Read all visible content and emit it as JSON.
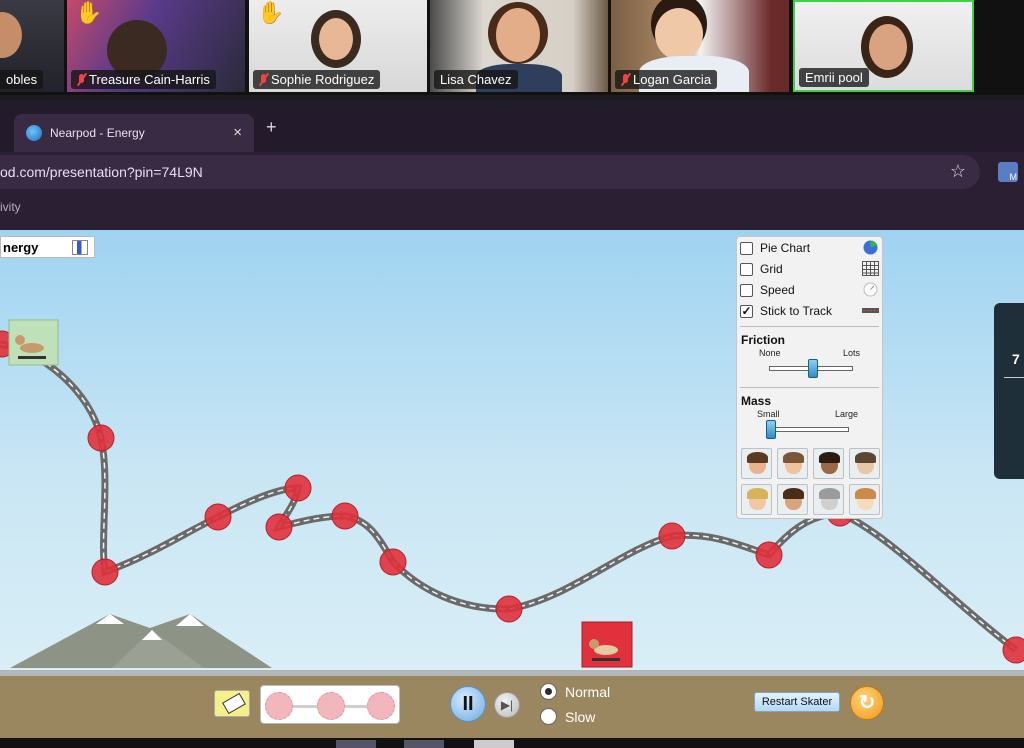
{
  "video_call": {
    "participants": [
      {
        "name": "obles",
        "muted": false,
        "hand_raised": false
      },
      {
        "name": "Treasure Cain-Harris",
        "muted": true,
        "hand_raised": true
      },
      {
        "name": "Sophie Rodriguez",
        "muted": true,
        "hand_raised": true
      },
      {
        "name": "Lisa Chavez",
        "muted": false,
        "hand_raised": false
      },
      {
        "name": "Logan Garcia",
        "muted": true,
        "hand_raised": false
      },
      {
        "name": "Emrii  pool",
        "muted": false,
        "hand_raised": false,
        "active_speaker": true
      }
    ],
    "hand_icon": "raised-hand-icon",
    "active_speaker_color": "#3fd14a"
  },
  "browser": {
    "tab_title": "Nearpod - Energy",
    "tab_close": "×",
    "new_tab": "+",
    "url": "od.com/presentation?pin=74L9N",
    "bookmark_text": "ivity",
    "extension_badge": "M"
  },
  "sim": {
    "energy_button_label": "nergy",
    "options": [
      {
        "label": "Pie Chart",
        "checked": false,
        "icon": "pie-chart-icon"
      },
      {
        "label": "Grid",
        "checked": false,
        "icon": "grid-icon"
      },
      {
        "label": "Speed",
        "checked": false,
        "icon": "speedometer-icon"
      },
      {
        "label": "Stick to Track",
        "checked": true,
        "icon": "track-icon"
      }
    ],
    "friction": {
      "title": "Friction",
      "min_label": "None",
      "max_label": "Lots",
      "value": 0.52
    },
    "mass": {
      "title": "Mass",
      "min_label": "Small",
      "max_label": "Large",
      "value": 0.0
    },
    "characters": [
      {
        "name": "girl-dark-hair",
        "hair": "#5a3a22",
        "skin": "#e9b48d"
      },
      {
        "name": "girl-bun",
        "hair": "#7a5636",
        "skin": "#f0c39f"
      },
      {
        "name": "boy-dark-skin",
        "hair": "#2b1b10",
        "skin": "#9a6a45"
      },
      {
        "name": "boy-short-hair",
        "hair": "#5b4633",
        "skin": "#e7c7a6"
      },
      {
        "name": "boy-blond",
        "hair": "#d8b25a",
        "skin": "#f1c7a1"
      },
      {
        "name": "girl-brown-hair",
        "hair": "#4a2d18",
        "skin": "#d7a47c"
      },
      {
        "name": "cat",
        "hair": "#9b9b9b",
        "skin": "#cfcfcf"
      },
      {
        "name": "dog",
        "hair": "#c98a4a",
        "skin": "#f3dcc0"
      }
    ],
    "speed_options": [
      {
        "label": "Normal",
        "selected": true
      },
      {
        "label": "Slow",
        "selected": false
      }
    ],
    "pause_label": "II",
    "step_label": "▶|",
    "restart_label": "Restart Skater",
    "reset_label": "↻",
    "right_panel_text": "7"
  }
}
